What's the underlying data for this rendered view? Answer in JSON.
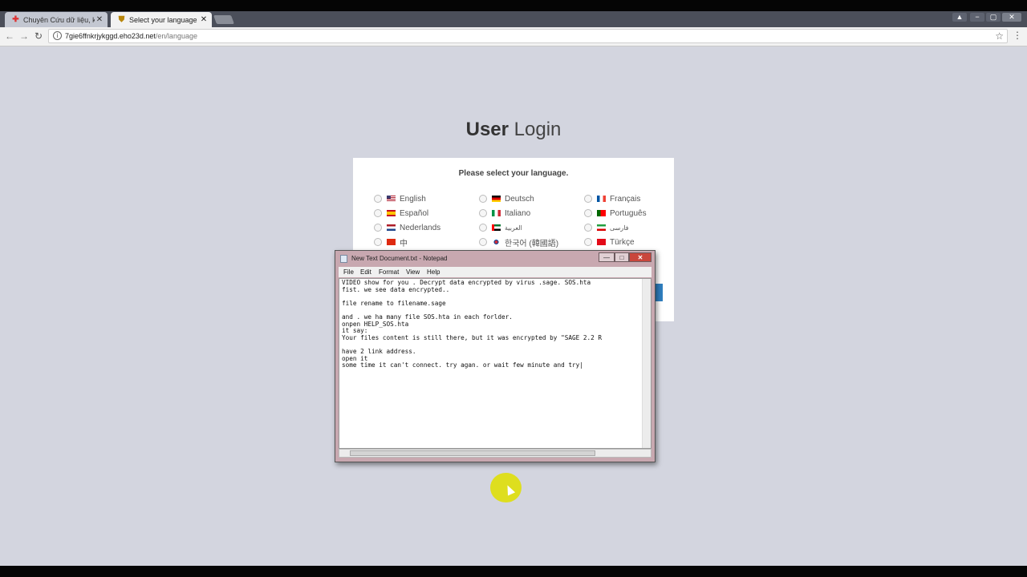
{
  "browser": {
    "tabs": [
      {
        "title": "Chuyên Cứu dữ liệu, khô",
        "favicon": "red-cross-icon",
        "active": false
      },
      {
        "title": "Select your language",
        "favicon": "shield-icon",
        "active": true
      }
    ],
    "window_controls": {
      "user": "▲",
      "minimize": "−",
      "maximize": "▢",
      "close": "✕"
    },
    "back": "←",
    "forward": "→",
    "reload": "↻",
    "url_host": "7gie6ffnkrjykggd.eho23d.net",
    "url_path": "/en/language",
    "star": "☆",
    "menu": "⋮"
  },
  "page": {
    "title_bold": "User",
    "title_light": "Login",
    "prompt": "Please select your language.",
    "languages": [
      {
        "label": "English",
        "flag": "us"
      },
      {
        "label": "Deutsch",
        "flag": "de"
      },
      {
        "label": "Français",
        "flag": "fr"
      },
      {
        "label": "Español",
        "flag": "es"
      },
      {
        "label": "Italiano",
        "flag": "it"
      },
      {
        "label": "Português",
        "flag": "pt"
      },
      {
        "label": "Nederlands",
        "flag": "nl"
      },
      {
        "label": "العربية",
        "flag": "ae"
      },
      {
        "label": "فارسی",
        "flag": "ir"
      },
      {
        "label": "中",
        "flag": "cn"
      },
      {
        "label": "한국어 (韓國語)",
        "flag": "kr"
      },
      {
        "label": "Türkçe",
        "flag": "tr"
      }
    ]
  },
  "notepad": {
    "title": "New Text Document.txt - Notepad",
    "menu": [
      "File",
      "Edit",
      "Format",
      "View",
      "Help"
    ],
    "buttons": {
      "minimize": "—",
      "maximize": "□",
      "close": "✕"
    },
    "content": "VIDEO show for you . Decrypt data encrypted by virus .sage. SOS.hta\nfist. we see data encrypted..\n\nfile rename to filename.sage\n\nand . we ha many file SOS.hta in each forlder.\nonpen HELP_SOS.hta\nit say:\nYour files content is still there, but it was encrypted by \"SAGE 2.2 R\n\nhave 2 link address.\nopen it\nsome time it can't connect. try agan. or wait few minute and try|"
  },
  "colors": {
    "page_bg": "#d3d5df",
    "button_blue": "#2f7fbf",
    "cursor_highlight": "#dede1e"
  }
}
